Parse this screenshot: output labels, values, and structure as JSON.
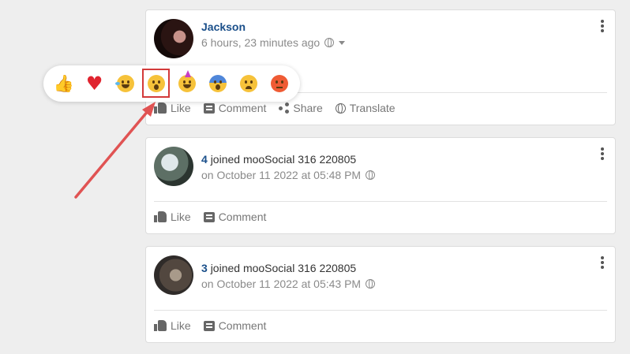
{
  "posts": [
    {
      "author": "Jackson",
      "time": "6 hours, 23 minutes ago",
      "actions": {
        "like": "Like",
        "comment": "Comment",
        "share": "Share",
        "translate": "Translate"
      }
    },
    {
      "user": "4",
      "text": "joined mooSocial 316 220805",
      "time": "on October 11 2022 at 05:48 PM",
      "actions": {
        "like": "Like",
        "comment": "Comment"
      }
    },
    {
      "user": "3",
      "text": "joined mooSocial 316 220805",
      "time": "on October 11 2022 at 05:43 PM",
      "actions": {
        "like": "Like",
        "comment": "Comment"
      }
    }
  ],
  "reactions": {
    "items": [
      "like",
      "love",
      "haha",
      "wow",
      "yay",
      "cool",
      "sad",
      "angry"
    ],
    "highlighted": "wow"
  },
  "colors": {
    "link": "#1a4f8a",
    "highlight": "#d33a3a",
    "arrow": "#e05353"
  }
}
